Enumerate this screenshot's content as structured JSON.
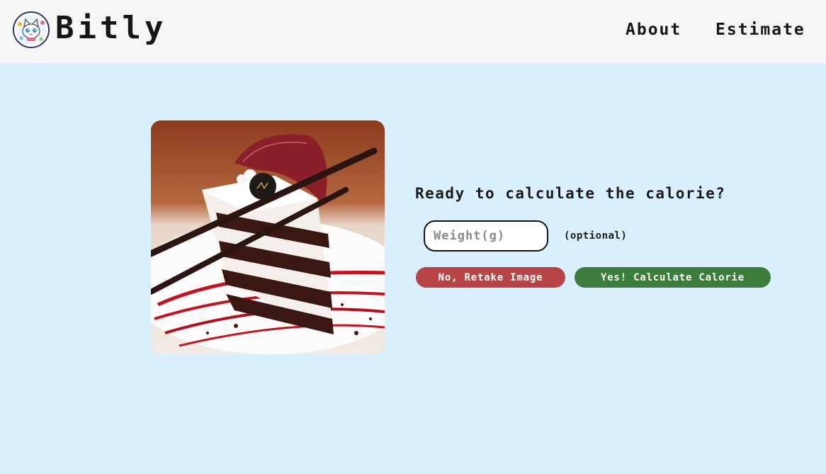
{
  "header": {
    "brand": "Bitly",
    "logo_icon": "cat-avatar-icon",
    "nav": [
      {
        "label": "About"
      },
      {
        "label": "Estimate"
      }
    ]
  },
  "main": {
    "image_subject": "red velvet cake slice",
    "question": "Ready to calculate the calorie?",
    "weight": {
      "value": "",
      "placeholder": "Weight(g)",
      "hint": "(optional)"
    },
    "buttons": {
      "retake_label": "No, Retake Image",
      "calculate_label": "Yes! Calculate Calorie"
    }
  },
  "colors": {
    "page_bg": "#d9effc",
    "header_bg": "#f6f6f6",
    "retake": "#b84448",
    "calculate": "#3c7d3c"
  }
}
